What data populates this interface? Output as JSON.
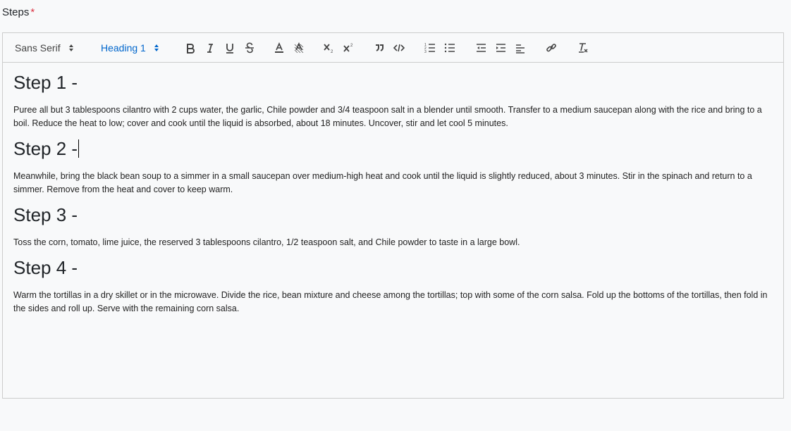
{
  "field": {
    "label": "Steps",
    "required_mark": "*"
  },
  "toolbar": {
    "font_picker": "Sans Serif",
    "header_picker": "Heading 1",
    "buttons": [
      {
        "name": "bold",
        "icon": "bold-icon"
      },
      {
        "name": "italic",
        "icon": "italic-icon"
      },
      {
        "name": "underline",
        "icon": "underline-icon"
      },
      {
        "name": "strike",
        "icon": "strikethrough-icon"
      },
      {
        "name": "color",
        "icon": "text-color-icon"
      },
      {
        "name": "background",
        "icon": "background-color-icon"
      },
      {
        "name": "subscript",
        "icon": "subscript-icon"
      },
      {
        "name": "superscript",
        "icon": "superscript-icon"
      },
      {
        "name": "blockquote",
        "icon": "blockquote-icon"
      },
      {
        "name": "code-block",
        "icon": "code-icon"
      },
      {
        "name": "ordered-list",
        "icon": "ordered-list-icon"
      },
      {
        "name": "bullet-list",
        "icon": "bullet-list-icon"
      },
      {
        "name": "outdent",
        "icon": "outdent-icon"
      },
      {
        "name": "indent",
        "icon": "indent-icon"
      },
      {
        "name": "align",
        "icon": "align-icon"
      },
      {
        "name": "link",
        "icon": "link-icon"
      },
      {
        "name": "clean",
        "icon": "clear-formatting-icon"
      }
    ]
  },
  "content": {
    "steps": [
      {
        "heading": "Step 1 -",
        "text": "Puree all but 3 tablespoons cilantro with 2 cups water, the garlic, Chile powder and 3/4 teaspoon salt in a blender until smooth. Transfer to a medium saucepan along with the rice and bring to a boil. Reduce the heat to low; cover and cook until the liquid is absorbed, about 18 minutes. Uncover, stir and let cool 5 minutes."
      },
      {
        "heading": "Step 2 -",
        "text": "Meanwhile, bring the black bean soup to a simmer in a small saucepan over medium-high heat and cook until the liquid is slightly reduced, about 3 minutes. Stir in the spinach and return to a simmer. Remove from the heat and cover to keep warm."
      },
      {
        "heading": "Step 3 -",
        "text": "Toss the corn, tomato, lime juice, the reserved 3 tablespoons cilantro, 1/2 teaspoon salt, and Chile powder to taste in a large bowl."
      },
      {
        "heading": "Step 4 -",
        "text": "Warm the tortillas in a dry skillet or in the microwave. Divide the rice, bean mixture and cheese among the tortillas; top with some of the corn salsa. Fold up the bottoms of the tortillas, then fold in the sides and roll up. Serve with the remaining corn salsa."
      }
    ]
  },
  "colors": {
    "accent": "#0066cc",
    "required": "#dc3545",
    "border": "#cccccc",
    "background": "#f8f9fa"
  }
}
